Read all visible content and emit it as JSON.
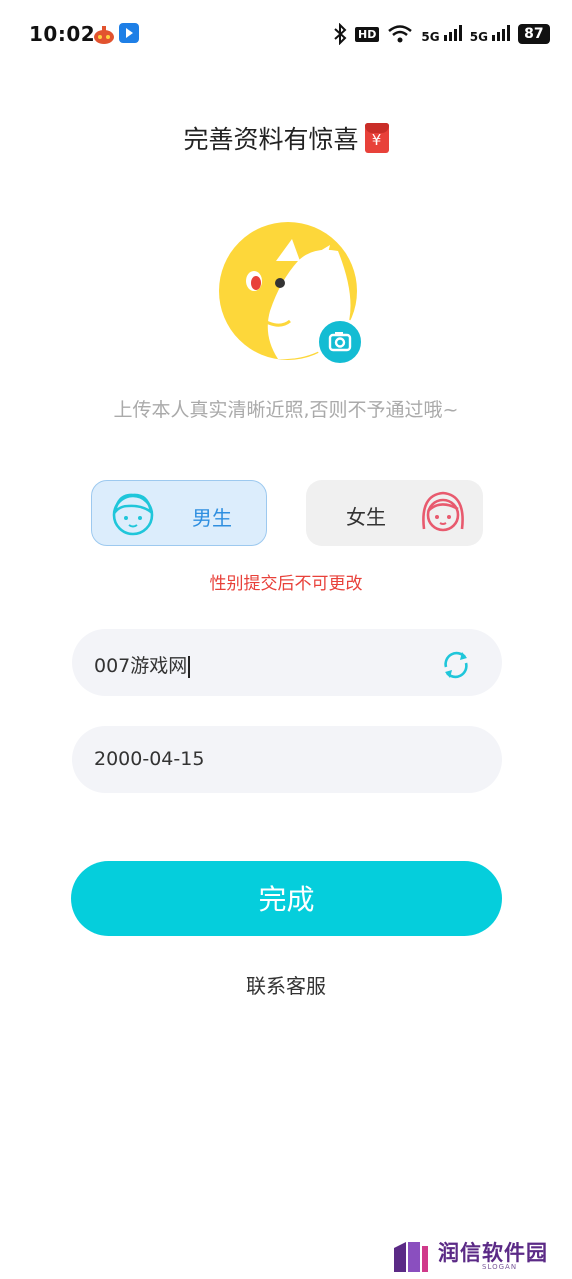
{
  "status_bar": {
    "time": "10:02",
    "hd_label": "HD",
    "signal_1": "5G",
    "signal_2": "5G",
    "battery": "87"
  },
  "header": {
    "title": "完善资料有惊喜",
    "red_packet_symbol": "¥"
  },
  "avatar": {
    "hint": "上传本人真实清晰近照,否则不予通过哦~"
  },
  "gender": {
    "male_label": "男生",
    "female_label": "女生",
    "selected": "男生",
    "warning": "性别提交后不可更改"
  },
  "form": {
    "nickname_value": "007游戏网",
    "birthday_value": "2000-04-15"
  },
  "actions": {
    "done_label": "完成",
    "contact_label": "联系客服"
  },
  "watermark": {
    "text": "润信软件园",
    "sub": "SLOGAN"
  },
  "colors": {
    "accent": "#05cedc",
    "male_blue": "#2f8fe0",
    "female_pink": "#e85a6e",
    "warning_red": "#e8413a"
  }
}
